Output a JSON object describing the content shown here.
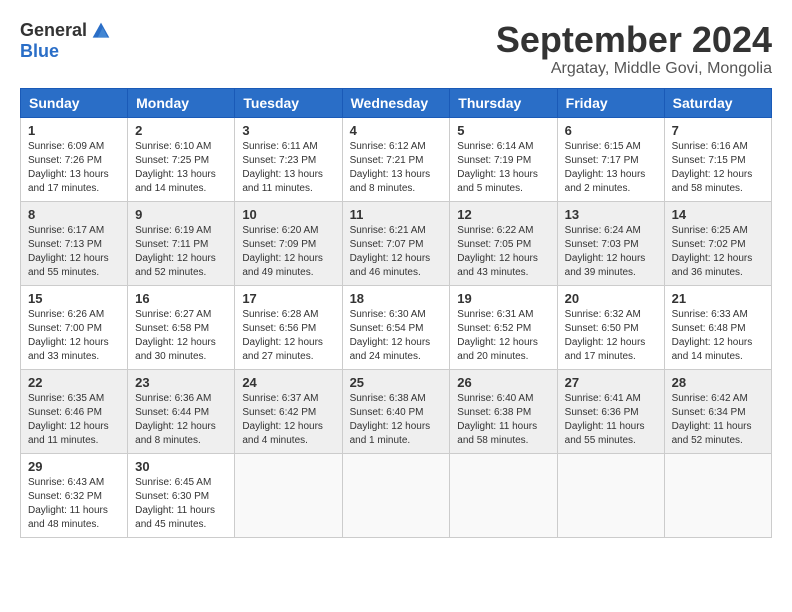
{
  "logo": {
    "general": "General",
    "blue": "Blue"
  },
  "title": "September 2024",
  "location": "Argatay, Middle Govi, Mongolia",
  "days_of_week": [
    "Sunday",
    "Monday",
    "Tuesday",
    "Wednesday",
    "Thursday",
    "Friday",
    "Saturday"
  ],
  "weeks": [
    [
      {
        "day": "1",
        "sunrise": "Sunrise: 6:09 AM",
        "sunset": "Sunset: 7:26 PM",
        "daylight": "Daylight: 13 hours and 17 minutes."
      },
      {
        "day": "2",
        "sunrise": "Sunrise: 6:10 AM",
        "sunset": "Sunset: 7:25 PM",
        "daylight": "Daylight: 13 hours and 14 minutes."
      },
      {
        "day": "3",
        "sunrise": "Sunrise: 6:11 AM",
        "sunset": "Sunset: 7:23 PM",
        "daylight": "Daylight: 13 hours and 11 minutes."
      },
      {
        "day": "4",
        "sunrise": "Sunrise: 6:12 AM",
        "sunset": "Sunset: 7:21 PM",
        "daylight": "Daylight: 13 hours and 8 minutes."
      },
      {
        "day": "5",
        "sunrise": "Sunrise: 6:14 AM",
        "sunset": "Sunset: 7:19 PM",
        "daylight": "Daylight: 13 hours and 5 minutes."
      },
      {
        "day": "6",
        "sunrise": "Sunrise: 6:15 AM",
        "sunset": "Sunset: 7:17 PM",
        "daylight": "Daylight: 13 hours and 2 minutes."
      },
      {
        "day": "7",
        "sunrise": "Sunrise: 6:16 AM",
        "sunset": "Sunset: 7:15 PM",
        "daylight": "Daylight: 12 hours and 58 minutes."
      }
    ],
    [
      {
        "day": "8",
        "sunrise": "Sunrise: 6:17 AM",
        "sunset": "Sunset: 7:13 PM",
        "daylight": "Daylight: 12 hours and 55 minutes."
      },
      {
        "day": "9",
        "sunrise": "Sunrise: 6:19 AM",
        "sunset": "Sunset: 7:11 PM",
        "daylight": "Daylight: 12 hours and 52 minutes."
      },
      {
        "day": "10",
        "sunrise": "Sunrise: 6:20 AM",
        "sunset": "Sunset: 7:09 PM",
        "daylight": "Daylight: 12 hours and 49 minutes."
      },
      {
        "day": "11",
        "sunrise": "Sunrise: 6:21 AM",
        "sunset": "Sunset: 7:07 PM",
        "daylight": "Daylight: 12 hours and 46 minutes."
      },
      {
        "day": "12",
        "sunrise": "Sunrise: 6:22 AM",
        "sunset": "Sunset: 7:05 PM",
        "daylight": "Daylight: 12 hours and 43 minutes."
      },
      {
        "day": "13",
        "sunrise": "Sunrise: 6:24 AM",
        "sunset": "Sunset: 7:03 PM",
        "daylight": "Daylight: 12 hours and 39 minutes."
      },
      {
        "day": "14",
        "sunrise": "Sunrise: 6:25 AM",
        "sunset": "Sunset: 7:02 PM",
        "daylight": "Daylight: 12 hours and 36 minutes."
      }
    ],
    [
      {
        "day": "15",
        "sunrise": "Sunrise: 6:26 AM",
        "sunset": "Sunset: 7:00 PM",
        "daylight": "Daylight: 12 hours and 33 minutes."
      },
      {
        "day": "16",
        "sunrise": "Sunrise: 6:27 AM",
        "sunset": "Sunset: 6:58 PM",
        "daylight": "Daylight: 12 hours and 30 minutes."
      },
      {
        "day": "17",
        "sunrise": "Sunrise: 6:28 AM",
        "sunset": "Sunset: 6:56 PM",
        "daylight": "Daylight: 12 hours and 27 minutes."
      },
      {
        "day": "18",
        "sunrise": "Sunrise: 6:30 AM",
        "sunset": "Sunset: 6:54 PM",
        "daylight": "Daylight: 12 hours and 24 minutes."
      },
      {
        "day": "19",
        "sunrise": "Sunrise: 6:31 AM",
        "sunset": "Sunset: 6:52 PM",
        "daylight": "Daylight: 12 hours and 20 minutes."
      },
      {
        "day": "20",
        "sunrise": "Sunrise: 6:32 AM",
        "sunset": "Sunset: 6:50 PM",
        "daylight": "Daylight: 12 hours and 17 minutes."
      },
      {
        "day": "21",
        "sunrise": "Sunrise: 6:33 AM",
        "sunset": "Sunset: 6:48 PM",
        "daylight": "Daylight: 12 hours and 14 minutes."
      }
    ],
    [
      {
        "day": "22",
        "sunrise": "Sunrise: 6:35 AM",
        "sunset": "Sunset: 6:46 PM",
        "daylight": "Daylight: 12 hours and 11 minutes."
      },
      {
        "day": "23",
        "sunrise": "Sunrise: 6:36 AM",
        "sunset": "Sunset: 6:44 PM",
        "daylight": "Daylight: 12 hours and 8 minutes."
      },
      {
        "day": "24",
        "sunrise": "Sunrise: 6:37 AM",
        "sunset": "Sunset: 6:42 PM",
        "daylight": "Daylight: 12 hours and 4 minutes."
      },
      {
        "day": "25",
        "sunrise": "Sunrise: 6:38 AM",
        "sunset": "Sunset: 6:40 PM",
        "daylight": "Daylight: 12 hours and 1 minute."
      },
      {
        "day": "26",
        "sunrise": "Sunrise: 6:40 AM",
        "sunset": "Sunset: 6:38 PM",
        "daylight": "Daylight: 11 hours and 58 minutes."
      },
      {
        "day": "27",
        "sunrise": "Sunrise: 6:41 AM",
        "sunset": "Sunset: 6:36 PM",
        "daylight": "Daylight: 11 hours and 55 minutes."
      },
      {
        "day": "28",
        "sunrise": "Sunrise: 6:42 AM",
        "sunset": "Sunset: 6:34 PM",
        "daylight": "Daylight: 11 hours and 52 minutes."
      }
    ],
    [
      {
        "day": "29",
        "sunrise": "Sunrise: 6:43 AM",
        "sunset": "Sunset: 6:32 PM",
        "daylight": "Daylight: 11 hours and 48 minutes."
      },
      {
        "day": "30",
        "sunrise": "Sunrise: 6:45 AM",
        "sunset": "Sunset: 6:30 PM",
        "daylight": "Daylight: 11 hours and 45 minutes."
      },
      null,
      null,
      null,
      null,
      null
    ]
  ]
}
